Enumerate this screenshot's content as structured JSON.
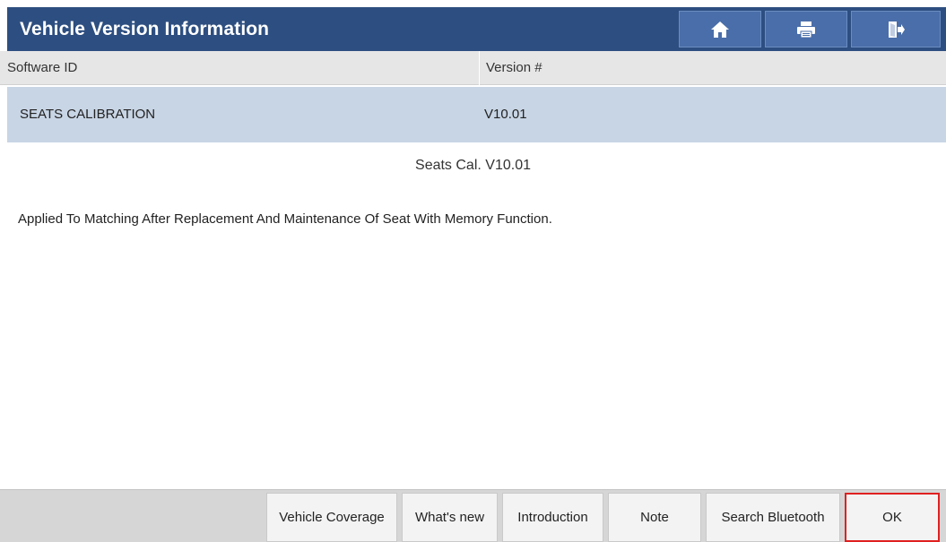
{
  "header": {
    "title": "Vehicle Version Information",
    "buttons": [
      {
        "name": "home",
        "icon": "home-icon"
      },
      {
        "name": "print",
        "icon": "print-icon"
      },
      {
        "name": "exit",
        "icon": "exit-icon"
      }
    ]
  },
  "table": {
    "columns": [
      "Software ID",
      "Version #"
    ],
    "rows": [
      {
        "software_id": "SEATS CALIBRATION",
        "version": "V10.01",
        "selected": true
      }
    ]
  },
  "detail": {
    "subtitle": "Seats Cal. V10.01",
    "description": "Applied To Matching After Replacement And Maintenance Of Seat With Memory Function."
  },
  "footer": {
    "buttons": [
      {
        "label": "Vehicle Coverage"
      },
      {
        "label": "What's new"
      },
      {
        "label": "Introduction"
      },
      {
        "label": "Note"
      },
      {
        "label": "Search Bluetooth"
      },
      {
        "label": "OK",
        "highlighted": true
      }
    ]
  },
  "colors": {
    "titlebar": "#2d4e80",
    "header_button": "#4a6ea9",
    "selected_row": "#c8d5e5",
    "ok_highlight": "#e02020"
  }
}
